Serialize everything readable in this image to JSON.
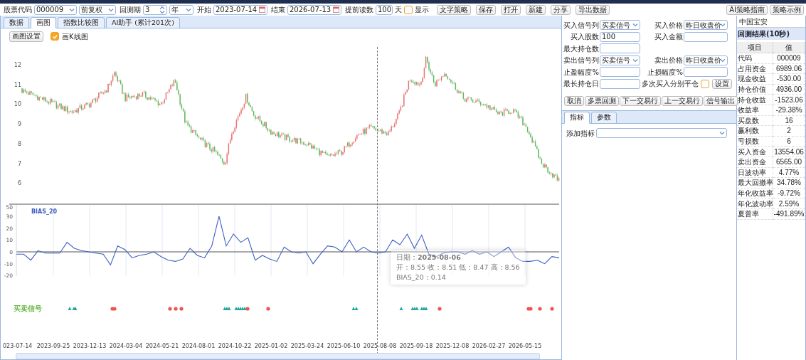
{
  "toolbar": {
    "fields": [
      {
        "kind": "select",
        "label": "股票代码",
        "value": "000009"
      },
      {
        "kind": "select",
        "value": "前复权"
      },
      {
        "kind": "spinner",
        "label": "回测期",
        "value": "3"
      },
      {
        "kind": "select",
        "value": "年"
      },
      {
        "kind": "date",
        "label": "开始",
        "value": "2023-07-14"
      },
      {
        "kind": "date",
        "label": "结束",
        "value": "2026-07-13"
      },
      {
        "kind": "text",
        "label": "提前读数",
        "value": "100",
        "suffix": "天"
      },
      {
        "kind": "checkbox",
        "label": "显示",
        "checked": false
      }
    ],
    "buttons": [
      "文字策略",
      "保存",
      "打开",
      "新建",
      "分享",
      "导出数据"
    ],
    "right_buttons": [
      "AI策略指南",
      "策略示例"
    ]
  },
  "tabs": [
    {
      "label": "数据",
      "selected": false
    },
    {
      "label": "画图",
      "selected": true
    },
    {
      "label": "指数比较图",
      "selected": false
    },
    {
      "label": "AI助手 (累计201次)",
      "selected": false
    }
  ],
  "chart_settings_button": "画图设置",
  "kline_checkbox": {
    "label": "画K线图",
    "checked": true
  },
  "price_yticks": [
    "12",
    "11",
    "10",
    "9",
    "8",
    "7",
    "6"
  ],
  "bias": {
    "axis_top_label": "50",
    "chart_data": {
      "type": "line",
      "ylim": [
        -20,
        40
      ],
      "grid": true,
      "yticks": [
        -20,
        -10,
        0,
        10,
        20,
        30
      ],
      "series": [
        {
          "name": "BIAS_20",
          "color": "#3d5fc4",
          "values": [
            -2,
            -2,
            -7,
            1,
            -1,
            -1,
            -1,
            8,
            3,
            1,
            0,
            -1,
            -2,
            -11,
            5,
            2,
            -5,
            -3,
            -2,
            0,
            -4,
            -7,
            -8,
            -6,
            3,
            -3,
            -5,
            5,
            30,
            5,
            15,
            8,
            12,
            -7,
            -3,
            -6,
            -8,
            4,
            0,
            -1,
            0,
            -10,
            -2,
            5,
            4,
            0,
            10,
            0,
            4,
            0,
            -1,
            0,
            10,
            6,
            15,
            3,
            14,
            -2,
            -4,
            -1,
            0,
            0,
            -2,
            1,
            -2,
            0,
            -4,
            0,
            4,
            -5,
            -8,
            -8,
            -7,
            -10,
            -4,
            -5
          ]
        }
      ]
    }
  },
  "signal_label": "买卖信号",
  "xticks": [
    "023-07-14",
    "2023-09-25",
    "2023-12-13",
    "2024-03-04",
    "2024-05-21",
    "2024-08-01",
    "2024-10-22",
    "2025-01-02",
    "2025-03-24",
    "2025-06-10",
    "2025-08-08",
    "2025-09-18",
    "2025-12-08",
    "2026-02-27",
    "2026-05-15"
  ],
  "tooltip": {
    "date_label": "日期：",
    "date": "2025-08-06",
    "prices": "开：8.55 收：8.51 低：8.47 高：8.56",
    "bias": "BIAS_20：0.14"
  },
  "form": [
    [
      {
        "kind": "select",
        "label": "买入信号列",
        "value": "买卖信号"
      },
      {
        "kind": "select",
        "label": "买入价格",
        "value": "昨日收盘价"
      }
    ],
    [
      {
        "kind": "text",
        "label": "买入股数",
        "value": "100"
      },
      {
        "kind": "text",
        "label": "买入金额"
      }
    ],
    [
      {
        "kind": "text",
        "label": "最大持仓数"
      }
    ],
    [
      {
        "kind": "select",
        "label": "卖出信号列",
        "value": "买卖信号"
      },
      {
        "kind": "select",
        "label": "卖出价格",
        "value": "昨日收盘价"
      }
    ],
    [
      {
        "kind": "text",
        "label": "止盈幅度%"
      },
      {
        "kind": "text",
        "label": "止损幅度%"
      }
    ],
    [
      {
        "kind": "text",
        "label": "最长持仓日"
      },
      {
        "kind": "checkbox",
        "label": "多次买入分别平仓",
        "checked": false,
        "button": "设置"
      }
    ]
  ],
  "actions": [
    "取消",
    "多票回测",
    "下一交易行",
    "上一交易行",
    "信号输出"
  ],
  "indicator_tabs": [
    {
      "label": "指标",
      "selected": true
    },
    {
      "label": "参数",
      "selected": false
    }
  ],
  "add_indicator": {
    "label": "添加指标"
  },
  "results": {
    "stock_name": "中国宝安",
    "title": "回测结果(10秒)",
    "columns": [
      "项目",
      "值"
    ],
    "rows": [
      [
        "代码",
        "000009"
      ],
      [
        "占用资金",
        "6989.06"
      ],
      [
        "现金收益",
        "-530.00"
      ],
      [
        "持仓价值",
        "4936.00"
      ],
      [
        "持仓收益",
        "-1523.06"
      ],
      [
        "收益率",
        "-29.38%"
      ],
      [
        "买盘数",
        "16"
      ],
      [
        "赢利数",
        "2"
      ],
      [
        "亏损数",
        "6"
      ],
      [
        "买入资金",
        "13554.06"
      ],
      [
        "卖出资金",
        "6565.00"
      ],
      [
        "日波动率",
        "4.77%"
      ],
      [
        "最大回撤率",
        "34.78%"
      ],
      [
        "年化收益率",
        "-9.72%"
      ],
      [
        "年化波动率",
        "2.59%"
      ],
      [
        "夏普率",
        "-491.89%"
      ]
    ]
  }
}
